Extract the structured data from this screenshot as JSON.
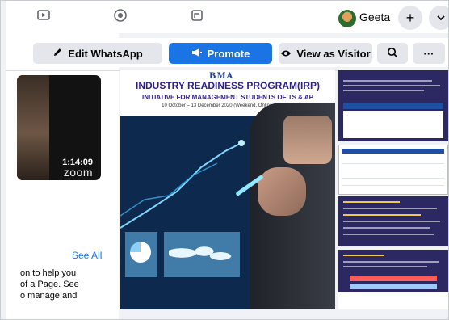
{
  "topbar": {
    "user_name": "Geeta",
    "icons": [
      "watch-icon",
      "marketplace-icon",
      "groups-icon",
      "plus-icon",
      "chevron-down-icon"
    ]
  },
  "actions": {
    "edit_whatsapp": "Edit WhatsApp",
    "promote": "Promote",
    "view_as_visitor": "View as Visitor",
    "more": "···"
  },
  "video": {
    "duration": "1:14:09",
    "watermark": "zoom"
  },
  "side_card": {
    "see_all": "See All",
    "text_lines": [
      "on to help you",
      "of a Page. See",
      "o manage and"
    ]
  },
  "post": {
    "logo": "BMA",
    "title": "INDUSTRY READINESS PROGRAM(IRP)",
    "subtitle": "INITIATIVE FOR MANAGEMENT STUDENTS OF TS & AP",
    "dates": "10 October – 13 December 2020 (Weekend, Online Program)"
  },
  "colors": {
    "accent": "#1b74e4",
    "button_grey": "#e4e6eb",
    "post_navy": "#0d2a4e",
    "thumb_purple": "#2c2862"
  }
}
